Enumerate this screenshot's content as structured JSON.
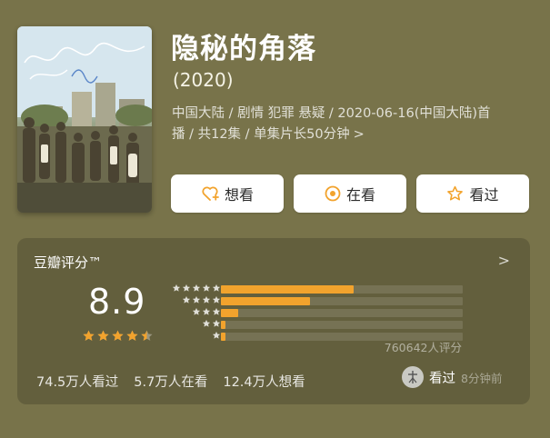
{
  "movie": {
    "title": "隐秘的角落",
    "year": "(2020)",
    "meta_line1": "中国大陆 / 剧情 犯罪 悬疑 / 2020-06-16(中国大陆)首",
    "meta_line2": "播 / 共12集 / 单集片长50分钟",
    "meta_chevron": ">"
  },
  "actions": {
    "want_label": "想看",
    "watching_label": "在看",
    "watched_label": "看过"
  },
  "rating": {
    "panel_title": "豆瓣评分™",
    "score": "8.9",
    "stars_value": 4.5,
    "distribution": [
      {
        "stars": 5,
        "fraction": 0.55
      },
      {
        "stars": 4,
        "fraction": 0.37
      },
      {
        "stars": 3,
        "fraction": 0.07
      },
      {
        "stars": 2,
        "fraction": 0.02
      },
      {
        "stars": 1,
        "fraction": 0.02
      }
    ],
    "rating_count": "760642人评分",
    "chevron": ">"
  },
  "stats": {
    "watched": "74.5万人看过",
    "watching": "5.7万人在看",
    "want": "12.4万人想看"
  },
  "user_status": {
    "label": "看过",
    "time": "8分钟前"
  },
  "colors": {
    "background": "#78734a",
    "star": "#f2a32d",
    "want_icon": "#f2a32d",
    "watching_icon": "#f2a32d",
    "watched_icon": "#f2a32d"
  }
}
